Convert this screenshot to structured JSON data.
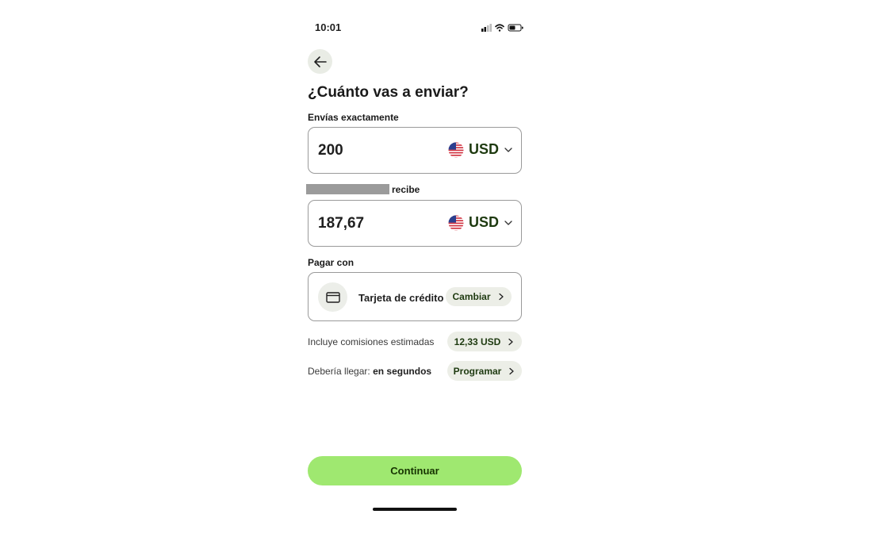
{
  "status_bar": {
    "time": "10:01"
  },
  "icons": {
    "back": "arrow-left-icon",
    "flag": "us-flag-icon",
    "card": "credit-card-icon",
    "chevron_down": "chevron-down-icon",
    "chevron_right": "chevron-right-icon"
  },
  "title": "¿Cuánto vas a enviar?",
  "send": {
    "label": "Envías exactamente",
    "amount": "200",
    "currency": "USD"
  },
  "receive": {
    "label": "recibe",
    "amount": "187,67",
    "currency": "USD"
  },
  "payment": {
    "label": "Pagar con",
    "method": "Tarjeta de crédito",
    "change_label": "Cambiar"
  },
  "fees": {
    "text": "Incluye comisiones estimadas",
    "amount": "12,33 USD"
  },
  "arrival": {
    "prefix": "Debería llegar:",
    "value": "en segundos",
    "schedule_label": "Programar"
  },
  "continue_label": "Continuar",
  "colors": {
    "accent": "#9fe870",
    "accent_text": "#163300",
    "pill_bg": "#eceee7"
  }
}
